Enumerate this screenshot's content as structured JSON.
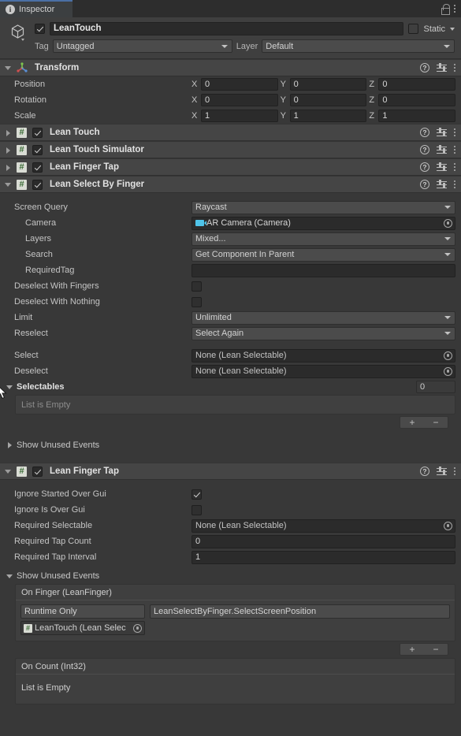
{
  "tab": {
    "label": "Inspector",
    "icon": "info-icon",
    "lock_icon": "lock-icon",
    "menu_icon": "kebab-menu-icon"
  },
  "gameobject": {
    "name": "LeanTouch",
    "enabled": true,
    "static_label": "Static",
    "tag_label": "Tag",
    "tag_value": "Untagged",
    "layer_label": "Layer",
    "layer_value": "Default"
  },
  "transform": {
    "title": "Transform",
    "rows": [
      {
        "label": "Position",
        "x": "0",
        "y": "0",
        "z": "0"
      },
      {
        "label": "Rotation",
        "x": "0",
        "y": "0",
        "z": "0"
      },
      {
        "label": "Scale",
        "x": "1",
        "y": "1",
        "z": "1"
      }
    ],
    "axes": {
      "x": "X",
      "y": "Y",
      "z": "Z"
    }
  },
  "collapsed_components": [
    {
      "title": "Lean Touch",
      "enabled": true
    },
    {
      "title": "Lean Touch Simulator",
      "enabled": true
    },
    {
      "title": "Lean Finger Tap",
      "enabled": true
    }
  ],
  "select_by_finger": {
    "title": "Lean Select By Finger",
    "enabled": true,
    "screen_query_label": "Screen Query",
    "screen_query_value": "Raycast",
    "camera_label": "Camera",
    "camera_value": "AR Camera (Camera)",
    "layers_label": "Layers",
    "layers_value": "Mixed...",
    "search_label": "Search",
    "search_value": "Get Component In Parent",
    "required_tag_label": "RequiredTag",
    "required_tag_value": "",
    "deselect_with_fingers_label": "Deselect With Fingers",
    "deselect_with_fingers_value": false,
    "deselect_with_nothing_label": "Deselect With Nothing",
    "deselect_with_nothing_value": false,
    "limit_label": "Limit",
    "limit_value": "Unlimited",
    "reselect_label": "Reselect",
    "reselect_value": "Select Again",
    "select_label": "Select",
    "select_value": "None (Lean Selectable)",
    "deselect_label": "Deselect",
    "deselect_value": "None (Lean Selectable)",
    "selectables_label": "Selectables",
    "selectables_size": "0",
    "selectables_empty": "List is Empty",
    "add_button": "+",
    "remove_button": "−",
    "show_unused_events": "Show Unused Events"
  },
  "finger_tap": {
    "title": "Lean Finger Tap",
    "enabled": true,
    "ignore_started_over_gui_label": "Ignore Started Over Gui",
    "ignore_started_over_gui_value": true,
    "ignore_is_over_gui_label": "Ignore Is Over Gui",
    "ignore_is_over_gui_value": false,
    "required_selectable_label": "Required Selectable",
    "required_selectable_value": "None (Lean Selectable)",
    "required_tap_count_label": "Required Tap Count",
    "required_tap_count_value": "0",
    "required_tap_interval_label": "Required Tap Interval",
    "required_tap_interval_value": "1",
    "show_unused_events": "Show Unused Events",
    "on_finger": {
      "title": "On Finger (LeanFinger)",
      "call_mode": "Runtime Only",
      "function": "LeanSelectByFinger.SelectScreenPosition",
      "target_object": "LeanTouch (Lean Selec",
      "add_button": "+",
      "remove_button": "−"
    },
    "on_count": {
      "title": "On Count (Int32)",
      "empty": "List is Empty"
    }
  },
  "colors": {
    "window_bg": "#383838",
    "header_bg": "#454545",
    "tab_accent": "#4a6fa5",
    "field_bg": "#2b2b2b",
    "dropdown_bg": "#4b4b4b",
    "script_icon_green": "#3a6b35",
    "camera_icon_cyan": "#4fc3e8"
  }
}
